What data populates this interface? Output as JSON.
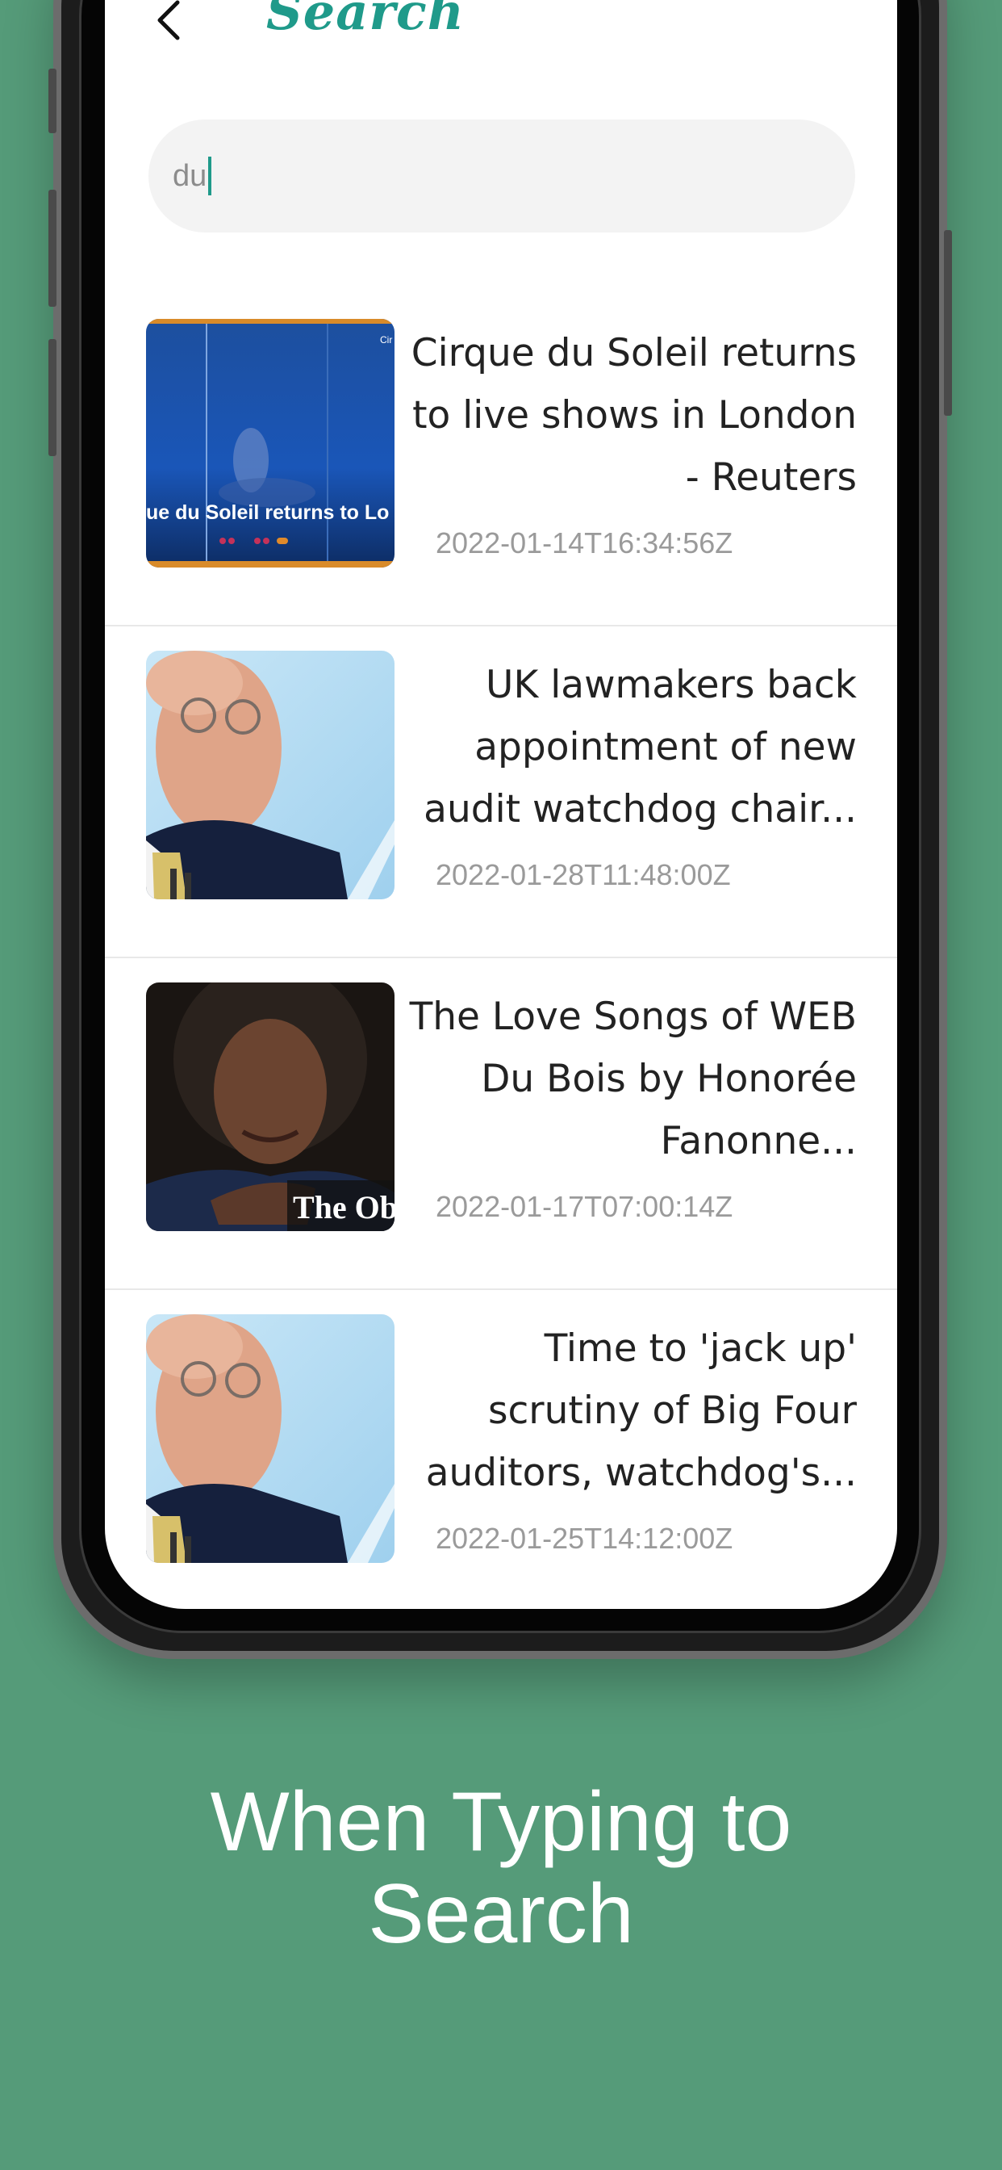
{
  "header": {
    "title": "Search",
    "back_icon": "chevron-left-icon"
  },
  "search": {
    "value": "du",
    "accent_color": "#1f9a8a"
  },
  "results": [
    {
      "title": "Cirque du Soleil returns to live shows in London - Reuters",
      "date": "2022-01-14T16:34:56Z",
      "thumb_caption": "ue du Soleil returns to Lo",
      "thumb_tag": "Cir"
    },
    {
      "title": "UK lawmakers back appointment of new audit watchdog chair...",
      "date": "2022-01-28T11:48:00Z"
    },
    {
      "title": "The Love Songs of WEB Du Bois by Honorée Fanonne...",
      "date": "2022-01-17T07:00:14Z",
      "thumb_caption": "The Ob"
    },
    {
      "title": "Time to 'jack up' scrutiny of Big Four auditors, watchdog's...",
      "date": "2022-01-25T14:12:00Z"
    }
  ],
  "caption": {
    "line1": "When Typing to",
    "line2": "Search"
  },
  "colors": {
    "background": "#559b79",
    "title": "#1f9a8a",
    "text": "#222222",
    "date": "#9a9a9a"
  }
}
